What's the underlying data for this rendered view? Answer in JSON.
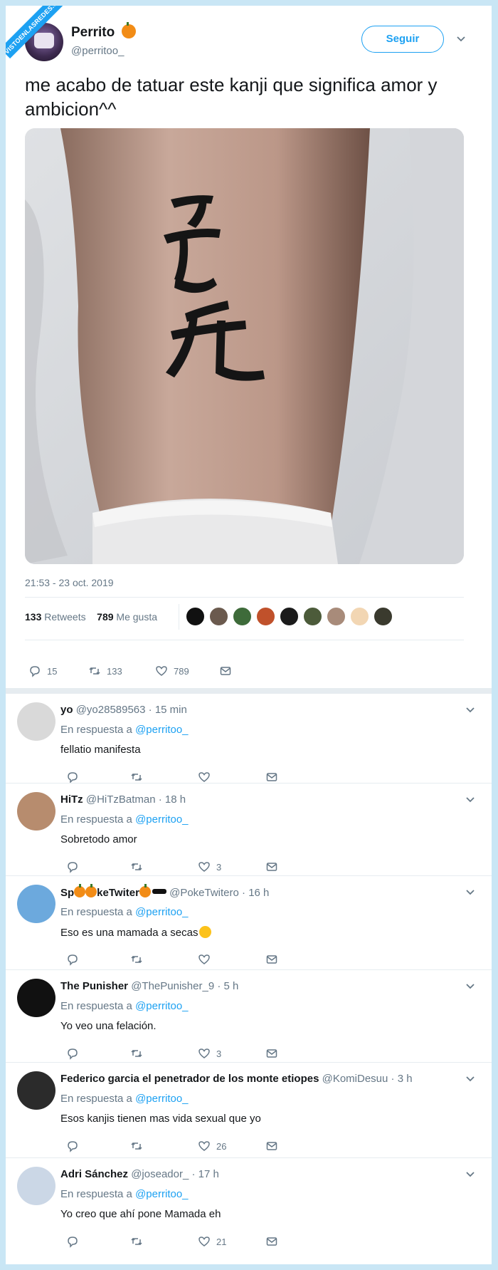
{
  "watermark": "VISTOENLASREDES.COM",
  "tweet": {
    "user_name": "Perrito",
    "user_handle": "@perritoo_",
    "follow_label": "Seguir",
    "text": "me acabo de tatuar este kanji que significa amor y ambicion^^",
    "timestamp": "21:53 - 23 oct. 2019",
    "retweets_count": "133",
    "retweets_label": "Retweets",
    "likes_count": "789",
    "likes_label": "Me gusta",
    "actions": {
      "replies": "15",
      "retweets": "133",
      "likes": "789"
    },
    "liker_colors": [
      "#111111",
      "#6b5a4e",
      "#3e6b3a",
      "#c0512b",
      "#1b1b1b",
      "#4c5b3a",
      "#a88b7a",
      "#f2d6b3",
      "#3a3a2e"
    ]
  },
  "replies_prefix": "En respuesta a",
  "replies": [
    {
      "name": "yo",
      "handle": "@yo28589563",
      "time": "· 15 min",
      "reply_to": "@perritoo_",
      "text": "fellatio manifesta",
      "likes": "",
      "avatar_color": "#d9d9d9"
    },
    {
      "name": "HiTz",
      "handle": "@HiTzBatman",
      "time": "· 18 h",
      "reply_to": "@perritoo_",
      "text": "Sobretodo amor",
      "likes": "3",
      "avatar_color": "#b78c6e"
    },
    {
      "name_parts": [
        "Sp",
        "keTwiter",
        ""
      ],
      "handle": "@PokeTwitero",
      "time": "· 16 h",
      "reply_to": "@perritoo_",
      "text": "Eso es una mamada a secas",
      "likes": "",
      "avatar_color": "#6ca9dd"
    },
    {
      "name": "The Punisher",
      "handle": "@ThePunisher_9",
      "time": "· 5 h",
      "reply_to": "@perritoo_",
      "text": "Yo veo una felación.",
      "likes": "3",
      "avatar_color": "#111111"
    },
    {
      "name": "Federico garcia el penetrador de los monte etiopes",
      "handle": "@KomiDesuu",
      "time": "· 3 h",
      "reply_to": "@perritoo_",
      "text": "Esos kanjis tienen mas vida sexual que yo",
      "likes": "26",
      "avatar_color": "#2b2b2b"
    },
    {
      "name": "Adri Sánchez",
      "handle": "@joseador_",
      "time": "· 17 h",
      "reply_to": "@perritoo_",
      "text": "Yo creo que ahí pone Mamada eh",
      "likes": "21",
      "avatar_color": "#cbd7e6"
    }
  ],
  "icons": [
    "reply-icon",
    "retweet-icon",
    "like-icon",
    "message-icon",
    "chevron-down-icon"
  ]
}
